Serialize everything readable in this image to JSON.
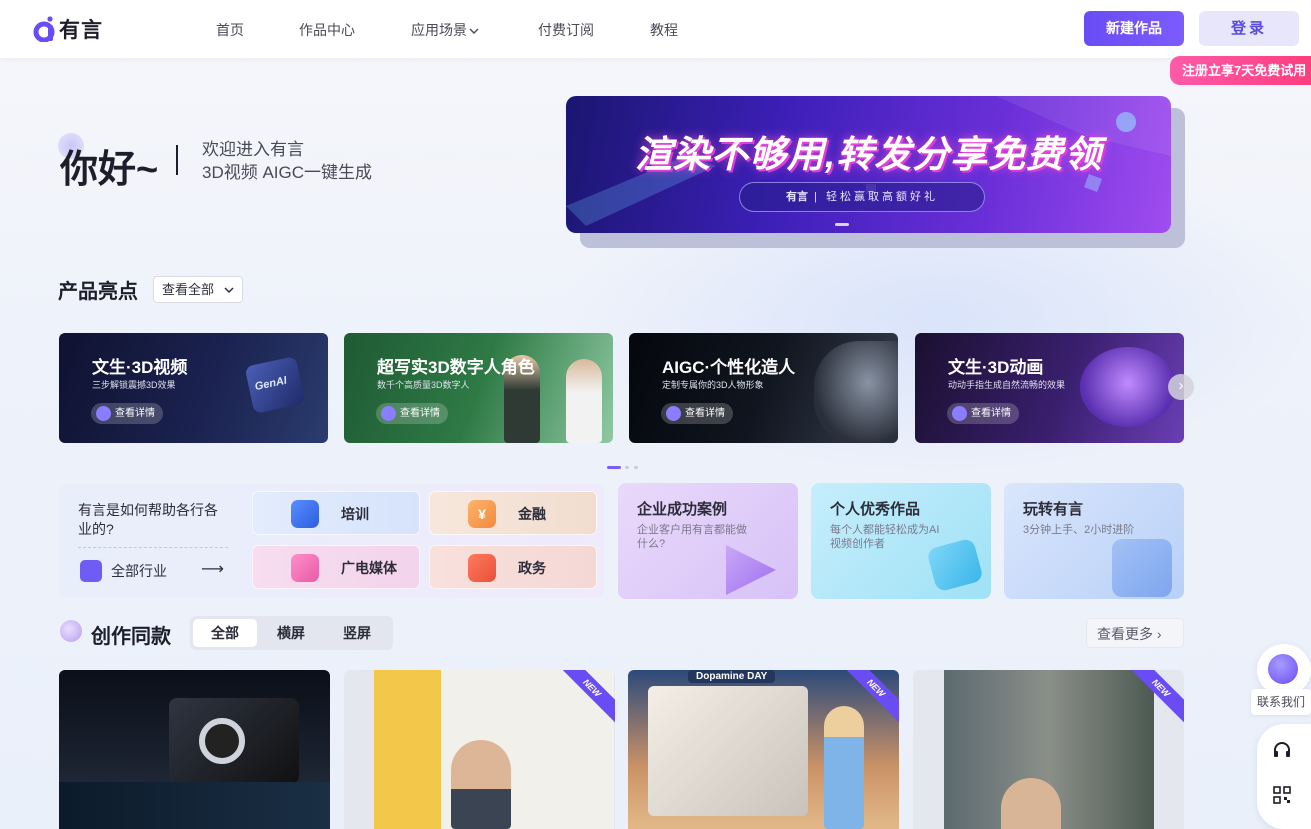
{
  "header": {
    "logo_text": "有言",
    "nav": [
      "首页",
      "作品中心",
      "应用场景",
      "付费订阅",
      "教程"
    ],
    "new_work_button": "新建作品",
    "login_button": "登录",
    "promo_tag": "注册立享7天免费试用"
  },
  "hero": {
    "greeting": "你好~",
    "welcome_line1": "欢迎进入有言",
    "welcome_line2": "3D视频 AIGC一键生成"
  },
  "banner": {
    "title": "渲染不够用,转发分享免费领",
    "pill_logo": "有言",
    "pill_text": "轻松赢取高额好礼"
  },
  "highlights": {
    "title": "产品亮点",
    "view_all": "查看全部",
    "cards": [
      {
        "title": "文生·3D视频",
        "subtitle": "三步解锁震撼3D效果",
        "button": "查看详情",
        "badge": "GenAI"
      },
      {
        "title": "超写实3D数字人角色",
        "subtitle": "数千个高质量3D数字人",
        "button": "查看详情"
      },
      {
        "title": "AIGC·个性化造人",
        "subtitle": "定制专属你的3D人物形象",
        "button": "查看详情"
      },
      {
        "title": "文生·3D动画",
        "subtitle": "动动手指生成自然流畅的效果",
        "button": "查看详情"
      }
    ]
  },
  "industries": {
    "question": "有言是如何帮助各行各业的?",
    "all_label": "全部行业",
    "arrow": "⟶",
    "items": [
      "培训",
      "金融",
      "广电媒体",
      "政务"
    ],
    "finance_symbol": "¥"
  },
  "cases": [
    {
      "title": "企业成功案例",
      "subtitle": "企业客户用有言都能做什么?"
    },
    {
      "title": "个人优秀作品",
      "subtitle": "每个人都能轻松成为AI视频创作者"
    },
    {
      "title": "玩转有言",
      "subtitle": "3分钟上手、2小时进阶"
    }
  ],
  "creation": {
    "title": "创作同款",
    "tabs": [
      "全部",
      "横屏",
      "竖屏"
    ],
    "active_tab": "全部",
    "more": "查看更多",
    "thumbs": [
      {
        "new": false
      },
      {
        "new": true,
        "badge": "NEW"
      },
      {
        "new": true,
        "badge": "NEW",
        "caption_top": "Dopamine DAY"
      },
      {
        "new": true,
        "badge": "NEW"
      }
    ]
  },
  "side": {
    "contact": "联系我们"
  },
  "colors": {
    "accent": "#6a4cf5",
    "promo": "#ff3d7f"
  }
}
